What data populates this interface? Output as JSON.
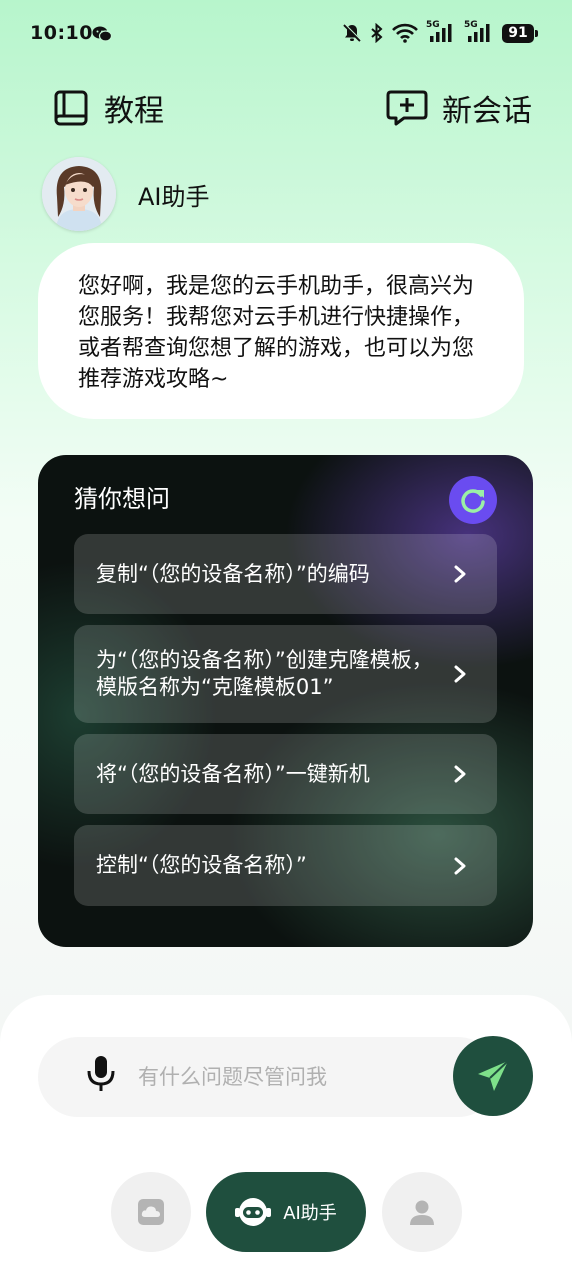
{
  "status_bar": {
    "time": "10:10",
    "battery": "91",
    "icons": [
      "wechat-icon",
      "mute-bell-icon",
      "bluetooth-icon",
      "wifi-icon",
      "signal-5g-icon",
      "signal-5g-icon",
      "battery-icon"
    ],
    "network_labels": [
      "5G",
      "5G"
    ]
  },
  "header": {
    "tutorial_label": "教程",
    "new_chat_label": "新会话"
  },
  "assistant": {
    "name": "AI助手",
    "greeting": "您好啊，我是您的云手机助手，很高兴为您服务！我帮您对云手机进行快捷操作，或者帮查询您想了解的游戏，也可以为您推荐游戏攻略~"
  },
  "suggestions": {
    "title": "猜你想问",
    "items": [
      {
        "text": "复制“（您的设备名称）”的编码"
      },
      {
        "text": "为“（您的设备名称）”创建克隆模板，模版名称为“克隆模板01”"
      },
      {
        "text": "将“（您的设备名称）”一键新机"
      },
      {
        "text": "控制“（您的设备名称）”"
      }
    ]
  },
  "input": {
    "placeholder": "有什么问题尽管问我",
    "value": ""
  },
  "bottom_nav": {
    "ai_label": "AI助手"
  },
  "colors": {
    "accent_dark_green": "#1f4f3e",
    "refresh_purple": "#6a4cf0",
    "send_arrow_green": "#7ee08a"
  }
}
